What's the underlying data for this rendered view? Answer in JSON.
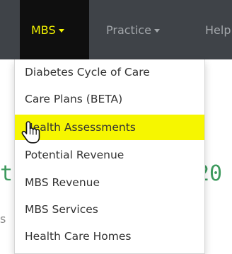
{
  "navbar": {
    "items": [
      {
        "label": "MBS",
        "active": true
      },
      {
        "label": "Practice",
        "active": false
      },
      {
        "label": "Help",
        "active": false
      }
    ]
  },
  "dropdown": {
    "items": [
      {
        "label": "Diabetes Cycle of Care"
      },
      {
        "label": "Care Plans (BETA)"
      },
      {
        "label": "Health Assessments",
        "highlighted": true
      },
      {
        "label": "Potential Revenue"
      },
      {
        "label": "MBS Revenue"
      },
      {
        "label": "MBS Services"
      },
      {
        "label": "Health Care Homes"
      }
    ]
  },
  "background": {
    "heading_left": "t",
    "heading_right": "20",
    "small_text": "s"
  },
  "colors": {
    "navbar_bg": "#3f4348",
    "active_tab_bg": "#0f0f0f",
    "active_tab_text": "#f5f500",
    "inactive_tab_text": "#a3a7ab",
    "highlight": "#f6f600",
    "heading_green": "#3e9a5e"
  },
  "icons": {
    "caret": "caret-down-icon",
    "cursor": "hand-pointer-cursor-icon"
  }
}
